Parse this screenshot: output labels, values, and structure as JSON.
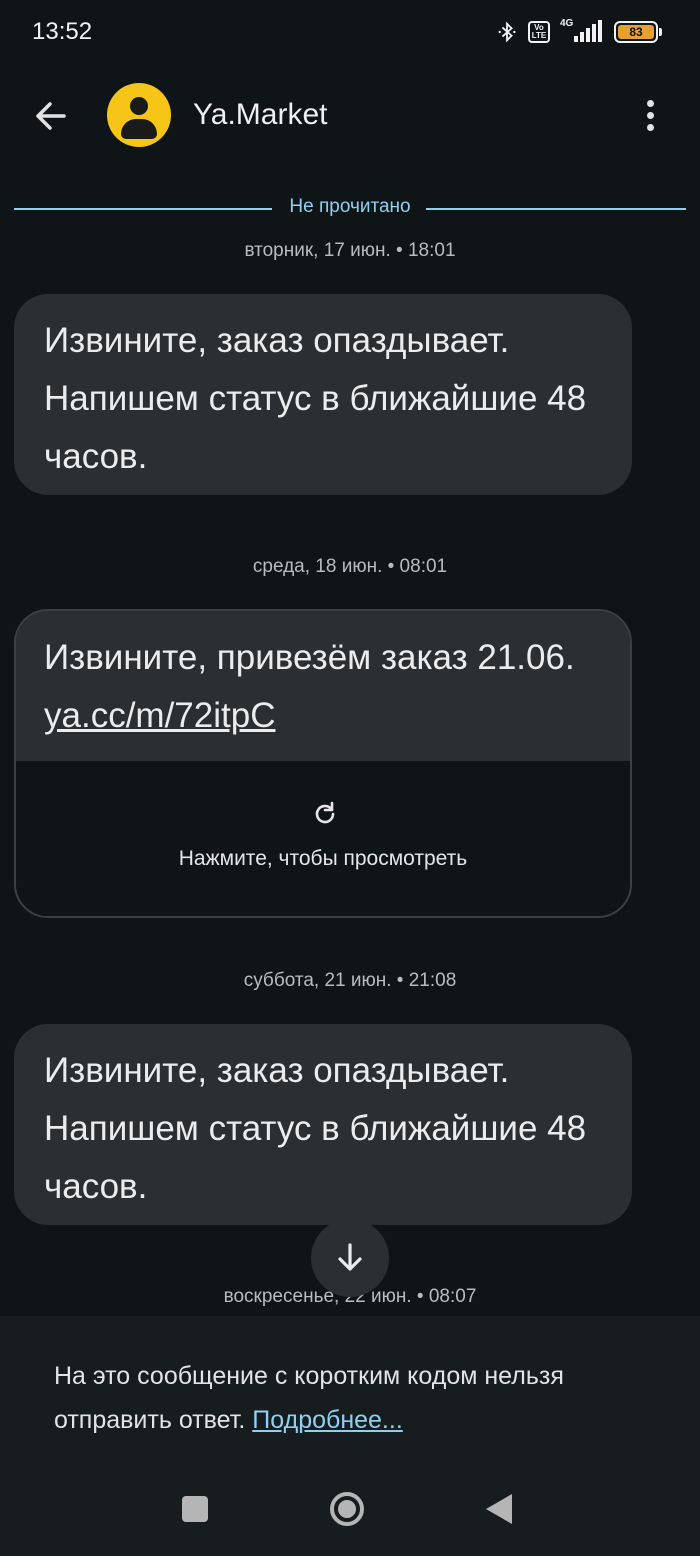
{
  "status_bar": {
    "time": "13:52",
    "network": "4G",
    "volte": "Vo LTE",
    "battery": "83",
    "icons": [
      "bluetooth-icon",
      "volte-icon",
      "signal-icon",
      "battery-icon"
    ]
  },
  "header": {
    "contact_name": "Ya.Market",
    "avatar_color": "#f5c518"
  },
  "unread_label": "Не прочитано",
  "messages": [
    {
      "timestamp": "вторник, 17 июн. • 18:01",
      "text": "Извините, заказ опаздывает. Напишем статус в ближайшие 48 часов."
    },
    {
      "timestamp": "среда, 18 июн. • 08:01",
      "text": "Извините, привезём заказ 21.06. ",
      "link": "ya.cc/m/72itpC",
      "preview_label": "Нажмите, чтобы просмотреть"
    },
    {
      "timestamp": "суббота, 21 июн. • 21:08",
      "text": "Извините, заказ опаздывает. Напишем статус в ближайшие 48 часов."
    },
    {
      "timestamp": "воскресенье, 22 июн. • 08:07"
    }
  ],
  "footer": {
    "notice": "На это сообщение с коротким кодом нельзя отправить ответ. ",
    "more_link": "Подробнее..."
  },
  "colors": {
    "background": "#0f1417",
    "bubble": "#2c2f32",
    "accent": "#8fd0f0",
    "battery": "#e8a030"
  }
}
